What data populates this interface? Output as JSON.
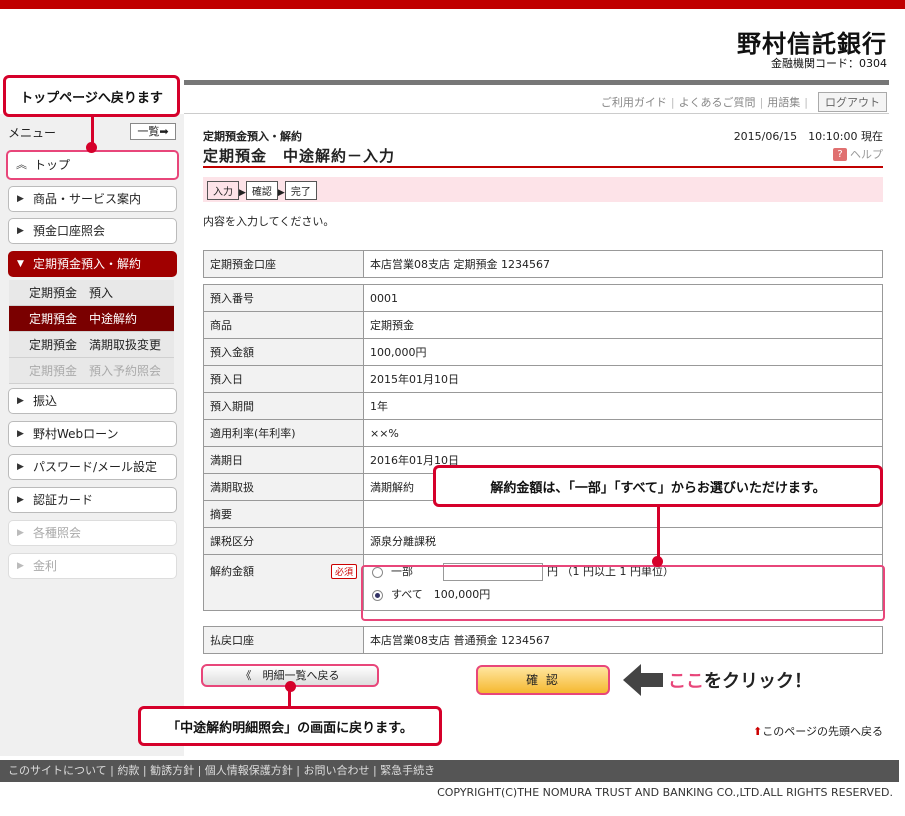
{
  "bank": {
    "name": "野村信託銀行",
    "code": "金融機関コード：0304"
  },
  "util": {
    "guide": "ご利用ガイド",
    "faq": "よくあるご質問",
    "glossary": "用語集",
    "logout": "ログアウト",
    "sep": "|"
  },
  "sidebar": {
    "menu_label": "メニュー",
    "list_label": "一覧",
    "items": [
      {
        "label": "トップ",
        "icon": "chevron-up-icon"
      },
      {
        "label": "商品・サービス案内",
        "icon": "triangle-right-icon"
      },
      {
        "label": "預金口座照会",
        "icon": "triangle-right-icon"
      },
      {
        "label": "定期預金預入・解約",
        "icon": "triangle-down-icon"
      },
      {
        "label": "振込",
        "icon": "triangle-right-icon"
      },
      {
        "label": "野村Webローン",
        "icon": "triangle-right-icon"
      },
      {
        "label": "パスワード/メール設定",
        "icon": "triangle-right-icon"
      },
      {
        "label": "認証カード",
        "icon": "triangle-right-icon"
      },
      {
        "label": "各種照会",
        "icon": "triangle-right-icon"
      },
      {
        "label": "金利",
        "icon": "triangle-right-icon"
      }
    ],
    "sub_items": [
      "定期預金　預入",
      "定期預金　中途解約",
      "定期預金　満期取扱変更",
      "定期預金　預入予約照会"
    ]
  },
  "callouts": {
    "top": "トップページへ戻ります",
    "amount": "解約金額は、「一部」「すべて」からお選びいただけます。",
    "back": "「中途解約明細照会」の画面に戻ります。"
  },
  "main": {
    "breadcrumb": "定期預金預入・解約",
    "datetime": "2015/06/15　10:10:00 現在",
    "title": "定期預金　中途解約－入力",
    "help": "ヘルプ",
    "help_q": "?",
    "steps": [
      "入力",
      "確認",
      "完了"
    ],
    "instruction": "内容を入力してください。",
    "account": {
      "label": "定期預金口座",
      "value": "本店営業08支店 定期預金 1234567"
    },
    "rows": [
      {
        "label": "預入番号",
        "value": "0001"
      },
      {
        "label": "商品",
        "value": "定期預金"
      },
      {
        "label": "預入金額",
        "value": "100,000円"
      },
      {
        "label": "預入日",
        "value": "2015年01月10日"
      },
      {
        "label": "預入期間",
        "value": "1年"
      },
      {
        "label": "適用利率(年利率)",
        "value": "××%"
      },
      {
        "label": "満期日",
        "value": "2016年01月10日"
      },
      {
        "label": "満期取扱",
        "value": "満期解約"
      },
      {
        "label": "摘要",
        "value": ""
      },
      {
        "label": "課税区分",
        "value": "源泉分離課税"
      }
    ],
    "amount": {
      "label": "解約金額",
      "required": "必須",
      "partial_label": "一部",
      "partial_value": "",
      "unit_note": "円 （1 円以上 1 円単位）",
      "all_label": "すべて　100,000円",
      "selected": "all"
    },
    "payout": {
      "label": "払戻口座",
      "value": "本店営業08支店 普通預金 1234567"
    },
    "back_button": "明細一覧へ戻る",
    "back_icon": "《",
    "confirm_button": "確 認",
    "click_hint_accent": "ここ",
    "click_hint_rest": "をクリック！",
    "page_top": "このページの先頭へ戻る"
  },
  "footer": {
    "links": [
      "このサイトについて",
      "約款",
      "勧誘方針",
      "個人情報保護方針",
      "お問い合わせ",
      "緊急手続き"
    ],
    "copyright": "COPYRIGHT(C)THE NOMURA TRUST AND BANKING CO.,LTD.ALL RIGHTS RESERVED."
  },
  "colors": {
    "brand": "#c00000",
    "callout": "#d5002a",
    "highlight": "#e8467a"
  }
}
